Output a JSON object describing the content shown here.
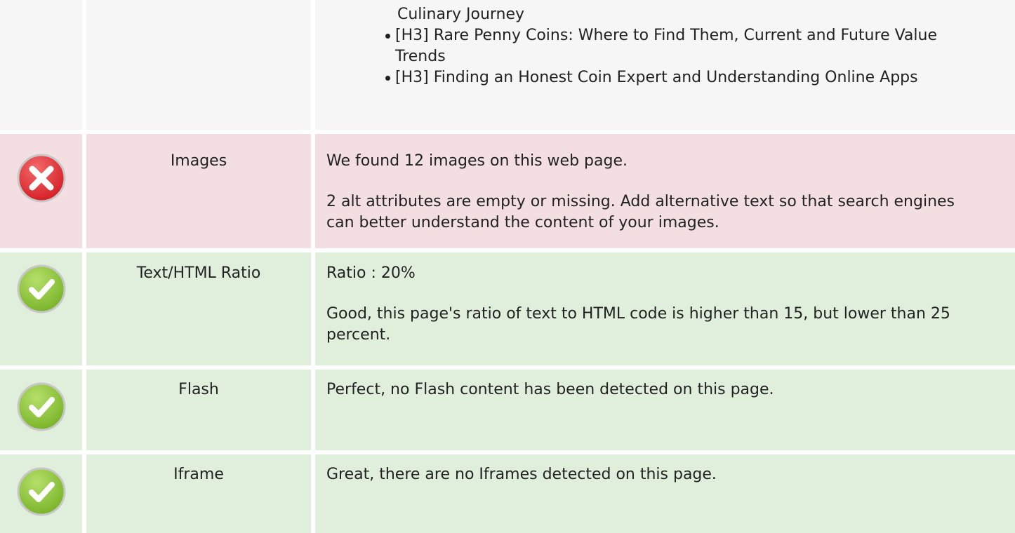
{
  "headings_list": {
    "continuation": "Culinary Journey",
    "items": [
      "[H3] Rare Penny Coins: Where to Find Them, Current and Future Value Trends",
      "[H3] Finding an Honest Coin Expert and Understanding Online Apps"
    ]
  },
  "rows": [
    {
      "status": "error",
      "icon": "error-x-icon",
      "name": "Images",
      "lines": [
        "We found 12 images on this web page.",
        "2 alt attributes are empty or missing. Add alternative text so that search engines can better understand the content of your images."
      ]
    },
    {
      "status": "ok",
      "icon": "check-icon",
      "name": "Text/HTML Ratio",
      "lines": [
        "Ratio : 20%",
        "Good, this page's ratio of text to HTML code is higher than 15, but lower than 25 percent."
      ]
    },
    {
      "status": "ok",
      "icon": "check-icon",
      "name": "Flash",
      "lines": [
        "Perfect, no Flash content has been detected on this page."
      ]
    },
    {
      "status": "ok",
      "icon": "check-icon",
      "name": "Iframe",
      "lines": [
        "Great, there are no Iframes detected on this page."
      ]
    }
  ],
  "colors": {
    "error_bg": "#f3dfe1",
    "ok_bg": "#e0efdb",
    "neutral_bg": "#f6f6f6",
    "error_icon": "#e0353a",
    "ok_icon": "#8cc63f"
  }
}
